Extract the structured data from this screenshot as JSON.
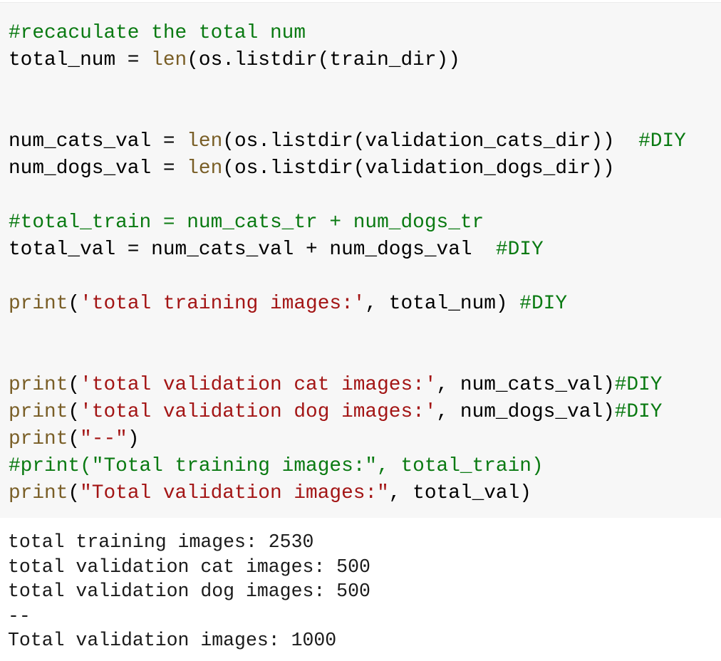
{
  "code_cell": {
    "lines": [
      [
        {
          "cls": "c",
          "text": "#recaculate the total num"
        }
      ],
      [
        {
          "cls": "t",
          "text": "total_num = "
        },
        {
          "cls": "k",
          "text": "len"
        },
        {
          "cls": "t",
          "text": "(os.listdir(train_dir))"
        }
      ],
      [],
      [],
      [
        {
          "cls": "t",
          "text": "num_cats_val = "
        },
        {
          "cls": "k",
          "text": "len"
        },
        {
          "cls": "t",
          "text": "(os.listdir(validation_cats_dir))  "
        },
        {
          "cls": "c",
          "text": "#DIY"
        }
      ],
      [
        {
          "cls": "t",
          "text": "num_dogs_val = "
        },
        {
          "cls": "k",
          "text": "len"
        },
        {
          "cls": "t",
          "text": "(os.listdir(validation_dogs_dir))"
        }
      ],
      [],
      [
        {
          "cls": "c",
          "text": "#total_train = num_cats_tr + num_dogs_tr"
        }
      ],
      [
        {
          "cls": "t",
          "text": "total_val = num_cats_val + num_dogs_val  "
        },
        {
          "cls": "c",
          "text": "#DIY"
        }
      ],
      [],
      [
        {
          "cls": "k",
          "text": "print"
        },
        {
          "cls": "t",
          "text": "("
        },
        {
          "cls": "s",
          "text": "'total training images:'"
        },
        {
          "cls": "t",
          "text": ", total_num) "
        },
        {
          "cls": "c",
          "text": "#DIY"
        }
      ],
      [],
      [],
      [
        {
          "cls": "k",
          "text": "print"
        },
        {
          "cls": "t",
          "text": "("
        },
        {
          "cls": "s",
          "text": "'total validation cat images:'"
        },
        {
          "cls": "t",
          "text": ", num_cats_val)"
        },
        {
          "cls": "c",
          "text": "#DIY"
        }
      ],
      [
        {
          "cls": "k",
          "text": "print"
        },
        {
          "cls": "t",
          "text": "("
        },
        {
          "cls": "s",
          "text": "'total validation dog images:'"
        },
        {
          "cls": "t",
          "text": ", num_dogs_val)"
        },
        {
          "cls": "c",
          "text": "#DIY"
        }
      ],
      [
        {
          "cls": "k",
          "text": "print"
        },
        {
          "cls": "t",
          "text": "("
        },
        {
          "cls": "s",
          "text": "\"--\""
        },
        {
          "cls": "t",
          "text": ")"
        }
      ],
      [
        {
          "cls": "c",
          "text": "#print(\"Total training images:\", total_train)"
        }
      ],
      [
        {
          "cls": "k",
          "text": "print"
        },
        {
          "cls": "t",
          "text": "("
        },
        {
          "cls": "s",
          "text": "\"Total validation images:\""
        },
        {
          "cls": "t",
          "text": ", total_val)"
        }
      ]
    ]
  },
  "output": {
    "lines": [
      "total training images: 2530",
      "total validation cat images: 500",
      "total validation dog images: 500",
      "--",
      "Total validation images: 1000"
    ]
  },
  "colors": {
    "comment": "#0a7a12",
    "builtin": "#795e26",
    "string": "#a31515",
    "code_background": "#f7f7f7"
  }
}
